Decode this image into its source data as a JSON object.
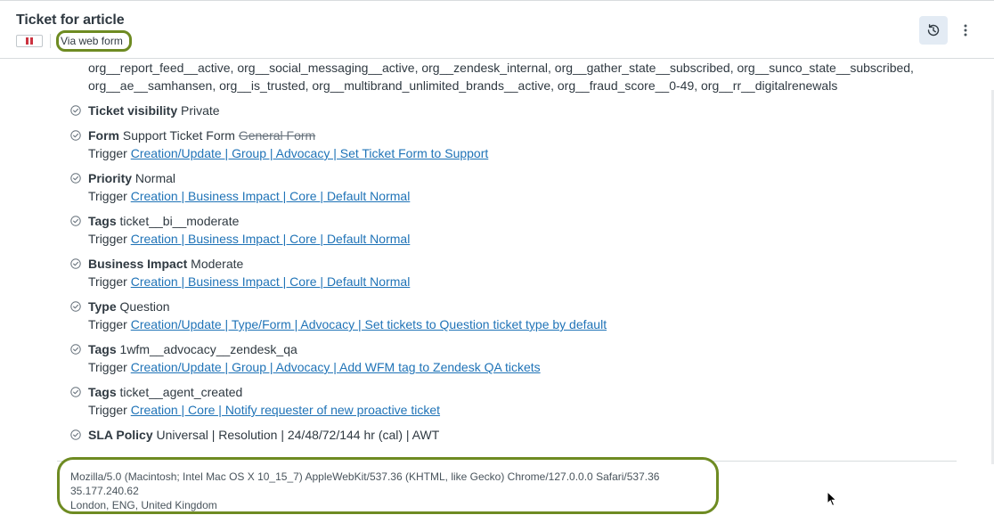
{
  "header": {
    "title": "Ticket for article",
    "status_tag": "Via web form"
  },
  "org_tags_text": "org__report_feed__active, org__social_messaging__active, org__zendesk_internal, org__gather_state__subscribed, org__sunco_state__subscribed, org__ae__samhansen, org__is_trusted, org__multibrand_unlimited_brands__active, org__fraud_score__0-49, org__rr__digitalrenewals",
  "events": [
    {
      "label": "Ticket visibility",
      "value": "Private",
      "old_value": "",
      "trigger_prefix": "",
      "trigger": ""
    },
    {
      "label": "Form",
      "value": "Support Ticket Form",
      "old_value": "General Form",
      "trigger_prefix": "Trigger",
      "trigger": "Creation/Update | Group | Advocacy | Set Ticket Form to Support"
    },
    {
      "label": "Priority",
      "value": "Normal",
      "old_value": "",
      "trigger_prefix": "Trigger",
      "trigger": "Creation | Business Impact | Core | Default Normal"
    },
    {
      "label": "Tags",
      "value": "ticket__bi__moderate",
      "old_value": "",
      "trigger_prefix": "Trigger",
      "trigger": "Creation | Business Impact | Core | Default Normal"
    },
    {
      "label": "Business Impact",
      "value": "Moderate",
      "old_value": "",
      "trigger_prefix": "Trigger",
      "trigger": "Creation | Business Impact | Core | Default Normal"
    },
    {
      "label": "Type",
      "value": "Question",
      "old_value": "",
      "trigger_prefix": "Trigger",
      "trigger": "Creation/Update | Type/Form | Advocacy | Set tickets to Question ticket type by default"
    },
    {
      "label": "Tags",
      "value": "1wfm__advocacy__zendesk_qa",
      "old_value": "",
      "trigger_prefix": "Trigger",
      "trigger": "Creation/Update | Group | Advocacy | Add WFM tag to Zendesk QA tickets"
    },
    {
      "label": "Tags",
      "value": "ticket__agent_created",
      "old_value": "",
      "trigger_prefix": "Trigger",
      "trigger": "Creation | Core | Notify requester of new proactive ticket"
    },
    {
      "label": "SLA Policy",
      "value": "Universal | Resolution | 24/48/72/144 hr (cal) | AWT",
      "old_value": "",
      "trigger_prefix": "",
      "trigger": ""
    }
  ],
  "metadata": {
    "user_agent": "Mozilla/5.0 (Macintosh; Intel Mac OS X 10_15_7) AppleWebKit/537.36 (KHTML, like Gecko) Chrome/127.0.0.0 Safari/537.36",
    "ip": "35.177.240.62",
    "location": "London, ENG, United Kingdom"
  },
  "colors": {
    "link": "#1f73b7",
    "highlight": "#6e8b22",
    "pause": "#cc3340",
    "history_bg": "#e3ebf4"
  },
  "icons": {
    "history": "history-icon",
    "more": "more-vertical-icon",
    "check": "check-circle-icon",
    "pause": "pause-icon"
  }
}
